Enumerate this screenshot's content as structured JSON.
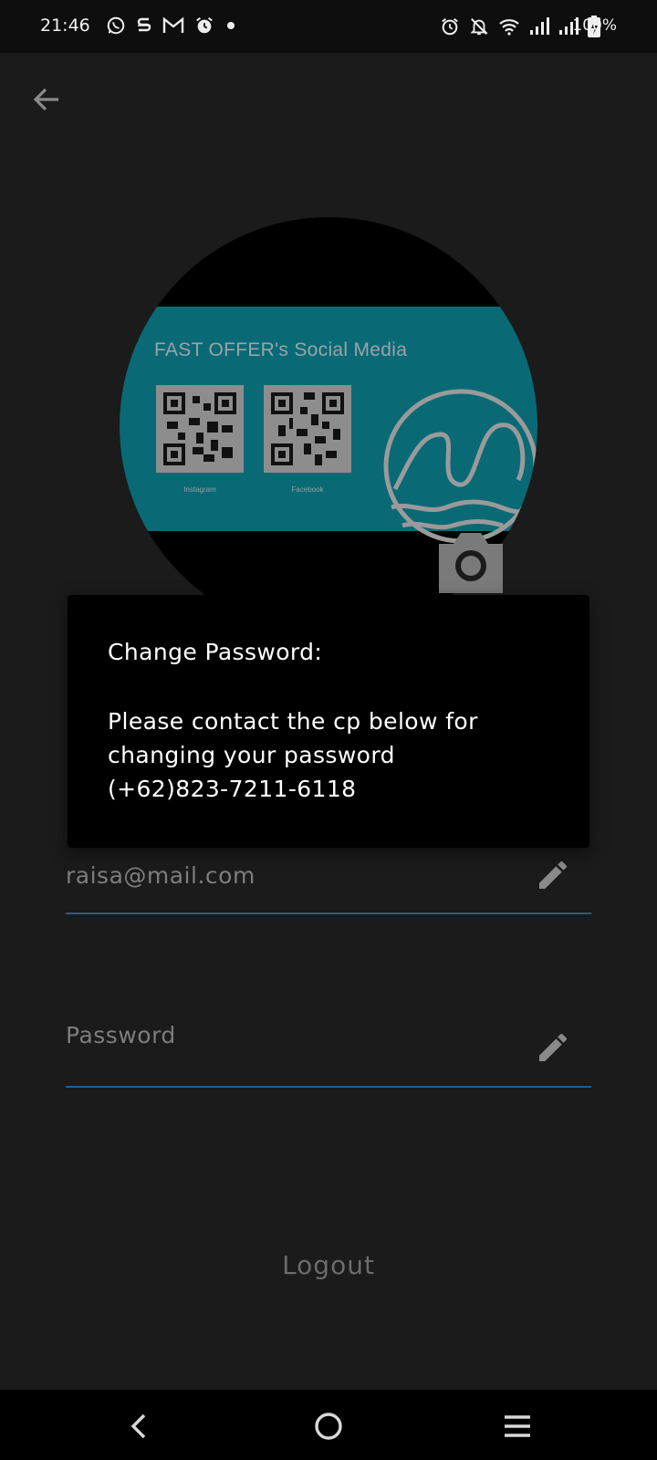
{
  "status_bar": {
    "time": "21:46",
    "left_icons": [
      "whatsapp-icon",
      "s-app-icon",
      "gmail-icon",
      "alarm-icon",
      "dot-icon"
    ],
    "right_icons": [
      "alarm-icon",
      "notifications-off-icon",
      "wifi-icon",
      "signal-icon",
      "signal-icon",
      "battery-charging-icon"
    ],
    "battery": "100%"
  },
  "header": {
    "back_icon": "arrow-back-icon"
  },
  "profile": {
    "card_title": "FAST OFFER's Social Media",
    "qr_labels": [
      "Instagram",
      "Facebook"
    ],
    "camera_icon": "camera-icon"
  },
  "form": {
    "email_value": "raisa@mail.com",
    "password_placeholder": "Password",
    "edit_icon": "pencil-icon"
  },
  "logout_label": "Logout",
  "dialog": {
    "title": "Change Password:",
    "message": "Please contact the cp below for changing your password\n(+62)823-7211-6118"
  },
  "nav_bar": {
    "icons": [
      "back-chevron-icon",
      "home-circle-icon",
      "recents-menu-icon"
    ]
  },
  "colors": {
    "background": "#1b1b1b",
    "card_teal": "#096a76",
    "underline_blue": "#1f5f8c",
    "dialog_bg": "#000000"
  }
}
